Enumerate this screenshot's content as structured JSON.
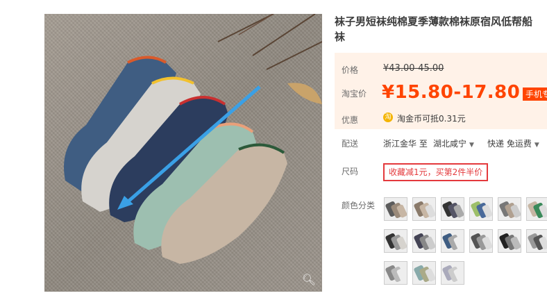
{
  "product": {
    "title_line1": "袜子男短袜纯棉夏季薄款棉袜原宿风低帮船",
    "title_line2": "袜"
  },
  "price": {
    "label": "价格",
    "original": "¥43.00-45.00",
    "taobao_label": "淘宝价",
    "taobao_price": "¥15.80-17.80",
    "mobile_badge": "手机专"
  },
  "discount": {
    "label": "优惠",
    "coin_icon_text": "淘",
    "text": "淘金币可抵0.31元"
  },
  "shipping": {
    "label": "配送",
    "from": "浙江金华 至",
    "to": "湖北咸宁",
    "method": "快递 免运费"
  },
  "size": {
    "label": "尺码",
    "promo": "收藏减1元，买第2件半价"
  },
  "colors": {
    "label": "颜色分类",
    "count": 15
  },
  "icons": {
    "zoom": "magnifier-icon",
    "coin": "taobao-coin-icon",
    "dropdown": "caret-down-icon"
  },
  "accent_colors": {
    "price": "#ff4400",
    "promo_border": "#e4393c",
    "price_bg": "#fff2e8"
  }
}
